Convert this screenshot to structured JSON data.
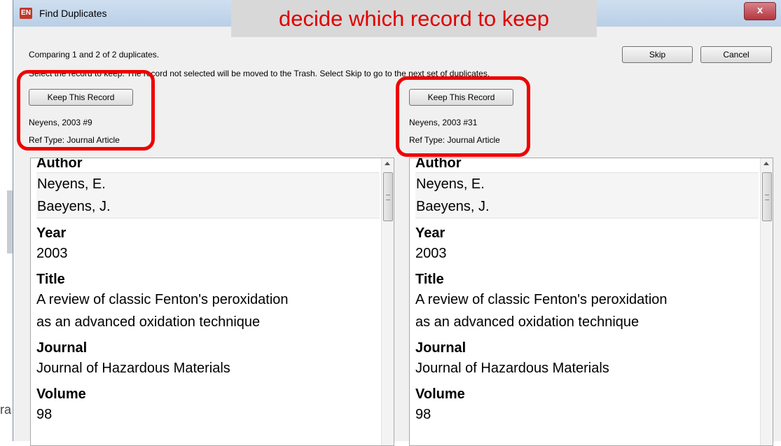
{
  "window": {
    "app_icon": "EN",
    "title": "Find Duplicates",
    "close_label": "x"
  },
  "annotation": "decide which record to keep",
  "status": "Comparing 1 and 2 of 2 duplicates.",
  "instructions": "Select the record to keep. The record not selected will be moved to the Trash. Select Skip to go to the next set of duplicates.",
  "buttons": {
    "skip": "Skip",
    "cancel": "Cancel"
  },
  "background_text": "ra",
  "records": [
    {
      "keep_label": "Keep This Record",
      "ref": "Neyens, 2003 #9",
      "ref_type": "Ref Type: Journal Article",
      "fields": {
        "author_label": "Author",
        "authors": [
          "Neyens, E.",
          "Baeyens, J."
        ],
        "year_label": "Year",
        "year": "2003",
        "title_label": "Title",
        "title_lines": [
          "A review of classic Fenton's peroxidation",
          "as an advanced oxidation technique"
        ],
        "journal_label": "Journal",
        "journal": "Journal of Hazardous Materials",
        "volume_label": "Volume",
        "volume": "98"
      }
    },
    {
      "keep_label": "Keep This Record",
      "ref": "Neyens, 2003 #31",
      "ref_type": "Ref Type: Journal Article",
      "fields": {
        "author_label": "Author",
        "authors": [
          "Neyens, E.",
          "Baeyens, J."
        ],
        "year_label": "Year",
        "year": "2003",
        "title_label": "Title",
        "title_lines": [
          "A review of classic Fenton's peroxidation",
          "as an advanced oxidation technique"
        ],
        "journal_label": "Journal",
        "journal": "Journal of Hazardous Materials",
        "volume_label": "Volume",
        "volume": "98"
      }
    }
  ],
  "icons": {
    "app": "endnote-app-icon",
    "close": "close-icon",
    "scroll_up": "scroll-up-arrow-icon"
  },
  "colors": {
    "annotation_text": "#e00000",
    "highlight_box": "#ee0000",
    "close_button": "#c44a53"
  }
}
